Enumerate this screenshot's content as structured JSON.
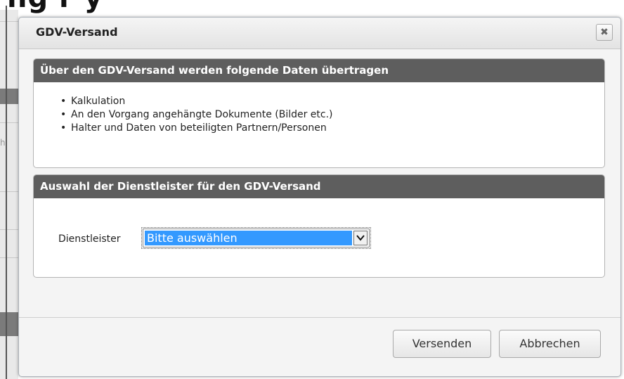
{
  "background": {
    "title_fragment": "ng  r y",
    "side_char": "h"
  },
  "dialog": {
    "title": "GDV-Versand",
    "close_glyph": "✖",
    "panel_info": {
      "header": "Über den GDV-Versand werden folgende Daten übertragen",
      "items": [
        "Kalkulation",
        "An den Vorgang angehängte Dokumente (Bilder etc.)",
        "Halter und Daten von beteiligten Partnern/Personen"
      ]
    },
    "panel_select": {
      "header": "Auswahl der Dienstleister für den GDV-Versand",
      "field_label": "Dienstleister",
      "select_value": "Bitte auswählen"
    },
    "buttons": {
      "send": "Versenden",
      "cancel": "Abbrechen"
    }
  },
  "icons": {
    "close": "close-icon",
    "dropdown": "chevron-down-icon",
    "bullet": "bullet-icon"
  },
  "colors": {
    "panel_header": "#5e5e5e",
    "select_highlight": "#3399ff"
  }
}
